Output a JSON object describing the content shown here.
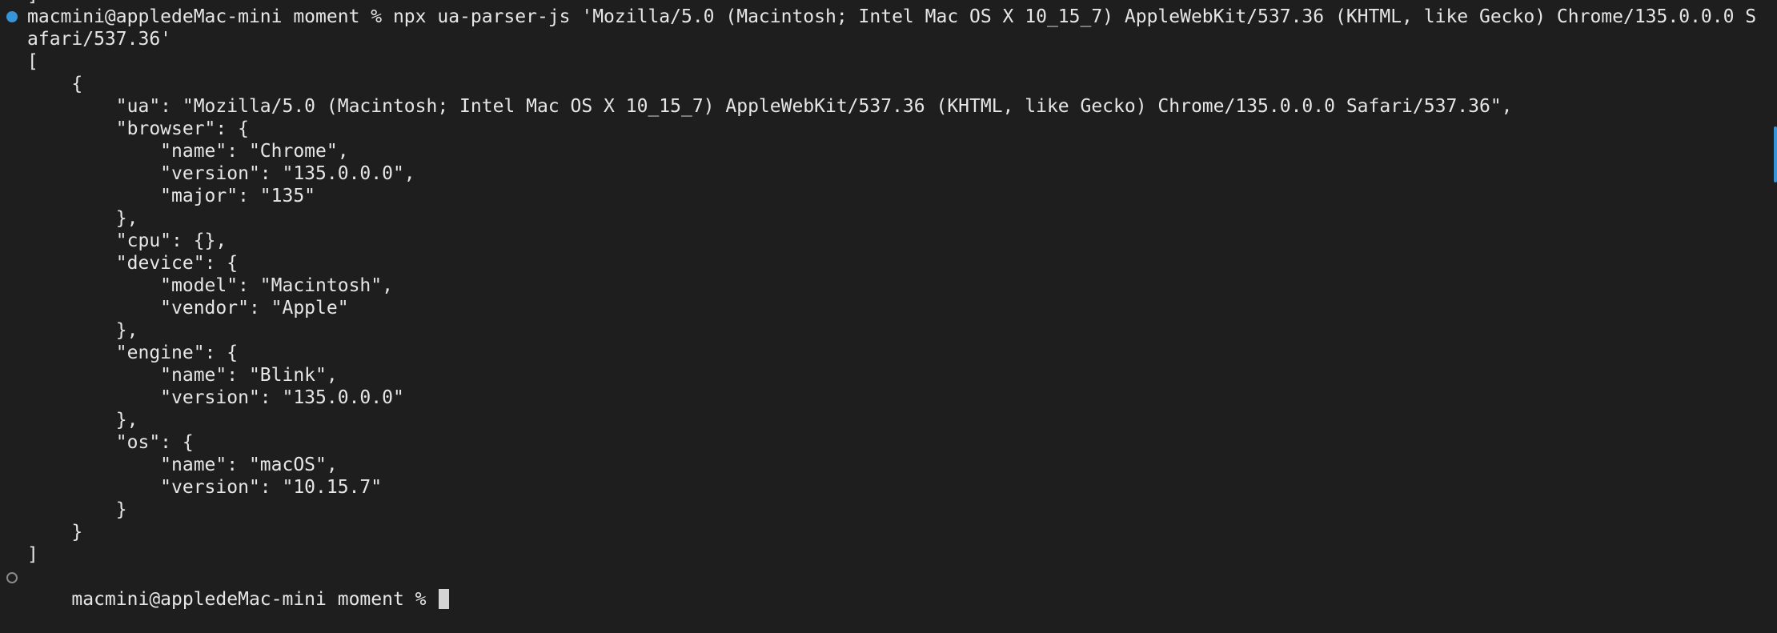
{
  "terminal": {
    "prev_tail": "]",
    "command_line_1": "macmini@appledeMac-mini moment % npx ua-parser-js 'Mozilla/5.0 (Macintosh; Intel Mac OS X 10_15_7) AppleWebKit/537.36 (KHTML, like Gecko) Chrome/135.0.0.0 S",
    "command_line_2": "afari/537.36'",
    "output": [
      "[",
      "    {",
      "        \"ua\": \"Mozilla/5.0 (Macintosh; Intel Mac OS X 10_15_7) AppleWebKit/537.36 (KHTML, like Gecko) Chrome/135.0.0.0 Safari/537.36\",",
      "        \"browser\": {",
      "            \"name\": \"Chrome\",",
      "            \"version\": \"135.0.0.0\",",
      "            \"major\": \"135\"",
      "        },",
      "        \"cpu\": {},",
      "        \"device\": {",
      "            \"model\": \"Macintosh\",",
      "            \"vendor\": \"Apple\"",
      "        },",
      "        \"engine\": {",
      "            \"name\": \"Blink\",",
      "            \"version\": \"135.0.0.0\"",
      "        },",
      "        \"os\": {",
      "            \"name\": \"macOS\",",
      "            \"version\": \"10.15.7\"",
      "        }",
      "    }",
      "]"
    ],
    "prompt": "macmini@appledeMac-mini moment % ",
    "colors": {
      "background": "#1e1e1e",
      "text": "#e6e6e6",
      "marker_success": "#3794d8",
      "marker_idle": "#8a8a8a"
    }
  }
}
